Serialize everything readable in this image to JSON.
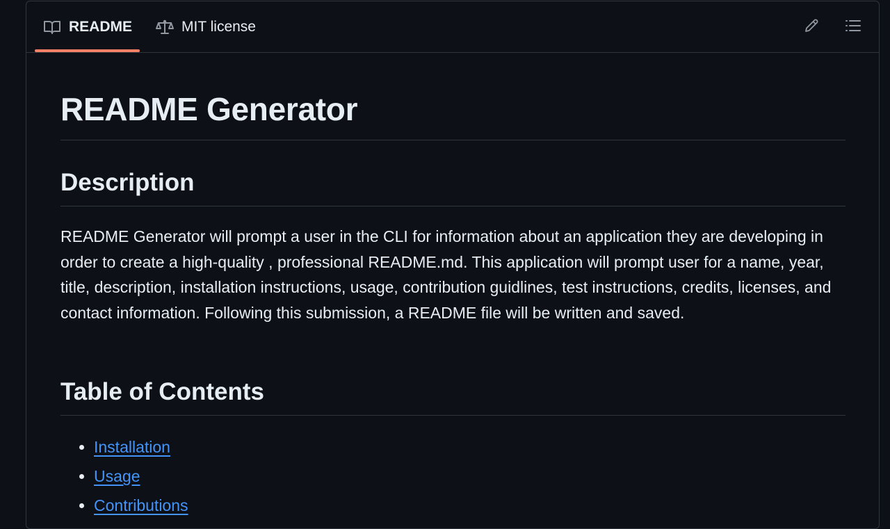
{
  "tabs": [
    {
      "label": "README",
      "icon": "book-icon",
      "active": true
    },
    {
      "label": "MIT license",
      "icon": "scale-icon",
      "active": false
    }
  ],
  "toolbar": {
    "edit_icon": "pencil-icon",
    "outline_icon": "list-icon"
  },
  "readme": {
    "title": "README Generator",
    "description_heading": "Description",
    "description_text": "README Generator will prompt a user in the CLI for information about an application they are developing in order to create a high-quality , professional README.md. This application will prompt user for a name, year, title, description, installation instructions, usage, contribution guidlines, test instructions, credits, licenses, and contact information. Following this submission, a README file will be written and saved.",
    "toc_heading": "Table of Contents",
    "toc": [
      "Installation",
      "Usage",
      "Contributions"
    ]
  },
  "colors": {
    "background": "#0d1117",
    "border": "#30363d",
    "text": "#e6edf3",
    "link": "#4493f8",
    "active_tab_underline": "#f78166"
  }
}
